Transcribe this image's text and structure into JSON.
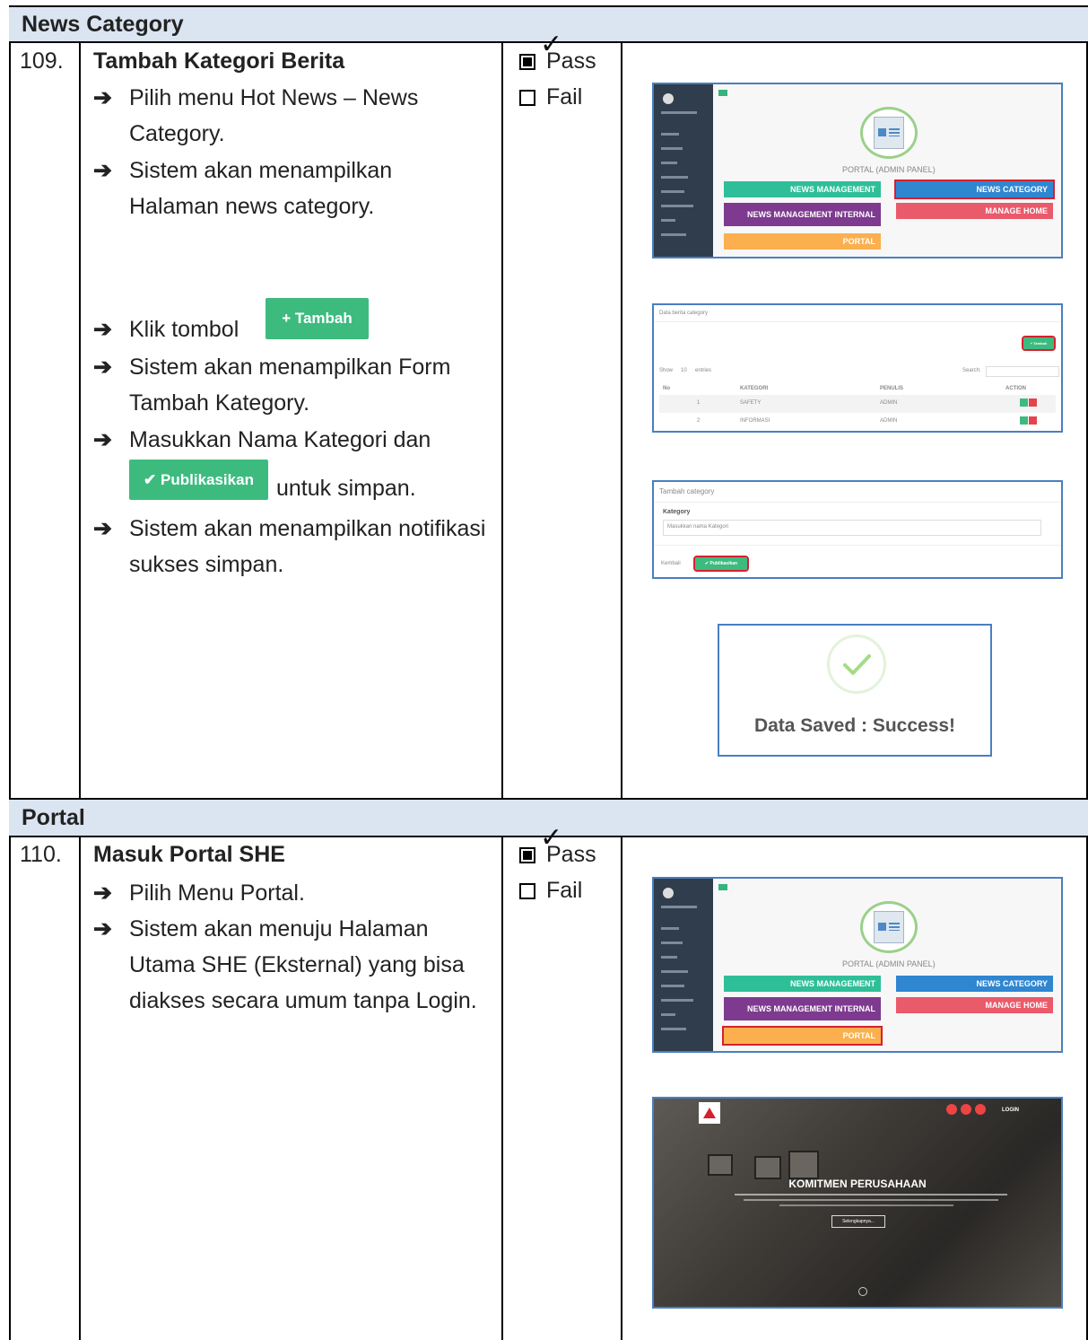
{
  "sections": [
    {
      "title": "News Category"
    },
    {
      "title": "Portal"
    }
  ],
  "rows": [
    {
      "number": "109.",
      "title": "Tambah Kategori Berita",
      "steps": [
        "Pilih menu Hot News – News Category.",
        "Sistem akan menampilkan Halaman news category.",
        "Klik tombol",
        "Sistem akan menampilkan Form Tambah Kategory.",
        "Masukkan Nama Kategori dan",
        "untuk simpan.",
        "Sistem akan menampilkan notifikasi sukses simpan."
      ],
      "tambah_button": "+ Tambah",
      "publikasikan_button": "✔ Publikasikan",
      "pass_label": "Pass",
      "fail_label": "Fail",
      "pass_checked": true
    },
    {
      "number": "110.",
      "title": "Masuk Portal SHE",
      "steps": [
        "Pilih Menu Portal.",
        "Sistem akan menuju Halaman Utama SHE (Eksternal) yang bisa diakses secara umum tanpa Login."
      ],
      "pass_label": "Pass",
      "fail_label": "Fail",
      "pass_checked": true
    }
  ],
  "admin_panel": {
    "title": "PORTAL (ADMIN PANEL)",
    "news_icon_label": "NEWS",
    "buttons": {
      "news_management": "NEWS MANAGEMENT",
      "news_category": "NEWS CATEGORY",
      "news_management_internal": "NEWS MANAGEMENT INTERNAL",
      "manage_home": "MANAGE HOME",
      "portal": "PORTAL"
    },
    "colors": {
      "news_management": "#2fbf98",
      "news_category": "#2f86d1",
      "news_management_internal": "#7d3a8f",
      "manage_home": "#e95a6b",
      "portal": "#fbaf4e"
    }
  },
  "list_panel": {
    "title": "Data berita category",
    "add_button": "+ Tambah",
    "search_label": "Search:",
    "show_label": "Show",
    "entries_label": "entries",
    "page_size": "10",
    "columns": [
      "No",
      "KATEGORI",
      "PENULIS",
      "ACTION"
    ],
    "rows": [
      {
        "no": "1",
        "kategori": "SAFETY",
        "penulis": "ADMIN"
      },
      {
        "no": "2",
        "kategori": "INFORMASI",
        "penulis": "ADMIN"
      }
    ]
  },
  "form_panel": {
    "title": "Tambah category",
    "field_label": "Kategory",
    "placeholder": "Masukkan nama Kategori",
    "back_button": "Kembali",
    "submit_button": "✔ Publikasikan"
  },
  "success": {
    "message": "Data Saved : Success!"
  },
  "portal_home": {
    "headline": "KOMITMEN PERUSAHAAN",
    "cta": "Selengkapnya...",
    "login_link": "LOGIN"
  }
}
